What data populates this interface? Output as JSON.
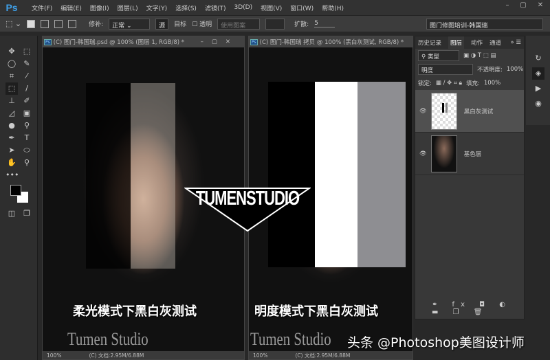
{
  "app": {
    "logo": "Ps"
  },
  "menu": [
    "文件(F)",
    "编辑(E)",
    "图像(I)",
    "图层(L)",
    "文字(Y)",
    "选择(S)",
    "滤镜(T)",
    "3D(D)",
    "视图(V)",
    "窗口(W)",
    "帮助(H)"
  ],
  "options": {
    "diffusion_label": "修补:",
    "diffusion_value": "正常",
    "source": "源",
    "target": "目标",
    "transparent": "透明",
    "use_pattern": "使用图案",
    "spread_label": "扩散:",
    "spread_value": "5",
    "workspace": "图门修图培训-韩国瑞"
  },
  "docs": [
    {
      "title": "(C) 图门-韩国瑞.psd @ 100% (图层 1, RGB/8) *",
      "zoom": "100%",
      "info": "(C) 文档:2.95M/6.88M",
      "caption": "柔光模式下黑白灰测试"
    },
    {
      "title": "(C) 图门-韩国瑞 拷贝 @ 100% (黑白灰测试, RGB/8) *",
      "zoom": "100%",
      "info": "(C) 文档:2.95M/6.88M",
      "caption": "明度模式下黑白灰测试"
    }
  ],
  "logo_text": "TUMENSTUDIO",
  "watermark_text": "Tumen Studio",
  "layers_panel": {
    "tabs": [
      "历史记录",
      "图层",
      "动作",
      "通道"
    ],
    "filter": "类型",
    "blend": "明度",
    "opacity_label": "不透明度:",
    "opacity": "100%",
    "lock_label": "锁定:",
    "fill_label": "填充:",
    "fill": "100%",
    "layers": [
      {
        "name": "黑白灰测试"
      },
      {
        "name": "基色层"
      }
    ]
  },
  "page_watermark": "头条 @Photoshop美图设计师"
}
